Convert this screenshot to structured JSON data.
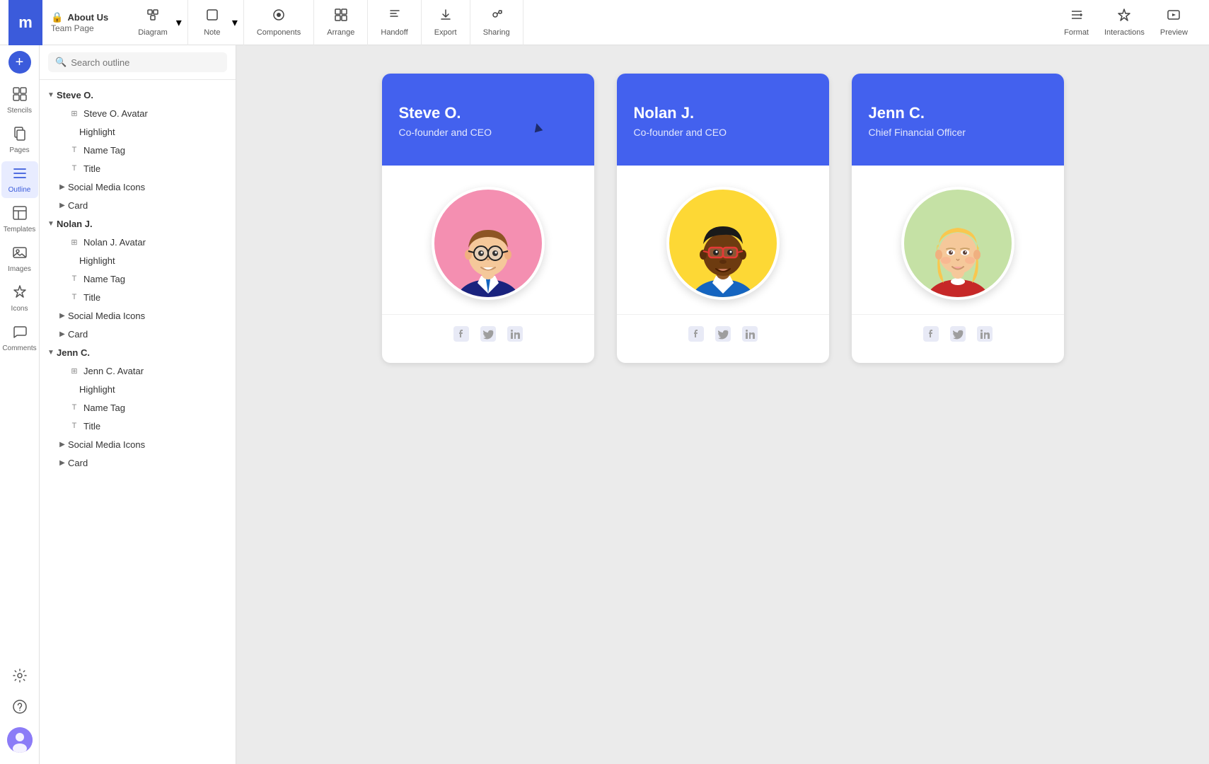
{
  "app": {
    "logo": "m",
    "breadcrumb": {
      "top": "About Us",
      "bottom": "Team Page"
    }
  },
  "toolbar": {
    "items": [
      {
        "id": "diagram",
        "label": "Diagram",
        "icon": "⬡"
      },
      {
        "id": "note",
        "label": "Note",
        "icon": "□"
      },
      {
        "id": "components",
        "label": "Components",
        "icon": "◉"
      },
      {
        "id": "arrange",
        "label": "Arrange",
        "icon": "⊞"
      },
      {
        "id": "handoff",
        "label": "Handoff",
        "icon": "</>"
      },
      {
        "id": "export",
        "label": "Export",
        "icon": "⬇"
      },
      {
        "id": "sharing",
        "label": "Sharing",
        "icon": "＋人"
      },
      {
        "id": "format",
        "label": "Format",
        "icon": "≡"
      },
      {
        "id": "interactions",
        "label": "Interactions",
        "icon": "⚡"
      },
      {
        "id": "preview",
        "label": "Preview",
        "icon": "▶"
      }
    ]
  },
  "rail": {
    "items": [
      {
        "id": "stencils",
        "label": "Stencils",
        "icon": "⊞",
        "active": false
      },
      {
        "id": "pages",
        "label": "Pages",
        "icon": "📄",
        "active": false
      },
      {
        "id": "outline",
        "label": "Outline",
        "icon": "☰",
        "active": true
      },
      {
        "id": "templates",
        "label": "Templates",
        "icon": "▤",
        "active": false
      },
      {
        "id": "images",
        "label": "Images",
        "icon": "🖼",
        "active": false
      },
      {
        "id": "icons",
        "label": "Icons",
        "icon": "✦",
        "active": false
      },
      {
        "id": "comments",
        "label": "Comments",
        "icon": "💬",
        "active": false
      }
    ]
  },
  "outline": {
    "search_placeholder": "Search outline",
    "tree": [
      {
        "id": "steve-root",
        "label": "Steve O.",
        "level": 0,
        "type": "group",
        "open": true
      },
      {
        "id": "steve-avatar",
        "label": "Steve O. Avatar",
        "level": 1,
        "type": "image",
        "open": false
      },
      {
        "id": "steve-highlight",
        "label": "Highlight",
        "level": 2,
        "type": "text",
        "open": false
      },
      {
        "id": "steve-nametag",
        "label": "Name Tag",
        "level": 1,
        "type": "text",
        "open": false
      },
      {
        "id": "steve-title",
        "label": "Title",
        "level": 1,
        "type": "text",
        "open": false
      },
      {
        "id": "steve-social",
        "label": "Social Media Icons",
        "level": 1,
        "type": "group",
        "open": false
      },
      {
        "id": "steve-card",
        "label": "Card",
        "level": 1,
        "type": "group",
        "open": false
      },
      {
        "id": "nolan-root",
        "label": "Nolan J.",
        "level": 0,
        "type": "group",
        "open": true
      },
      {
        "id": "nolan-avatar",
        "label": "Nolan J. Avatar",
        "level": 1,
        "type": "image",
        "open": false
      },
      {
        "id": "nolan-highlight",
        "label": "Highlight",
        "level": 2,
        "type": "text",
        "open": false
      },
      {
        "id": "nolan-nametag",
        "label": "Name Tag",
        "level": 1,
        "type": "text",
        "open": false
      },
      {
        "id": "nolan-title",
        "label": "Title",
        "level": 1,
        "type": "text",
        "open": false
      },
      {
        "id": "nolan-social",
        "label": "Social Media Icons",
        "level": 1,
        "type": "group",
        "open": false
      },
      {
        "id": "nolan-card",
        "label": "Card",
        "level": 1,
        "type": "group",
        "open": false
      },
      {
        "id": "jenn-root",
        "label": "Jenn C.",
        "level": 0,
        "type": "group",
        "open": true
      },
      {
        "id": "jenn-avatar",
        "label": "Jenn C. Avatar",
        "level": 1,
        "type": "image",
        "open": false
      },
      {
        "id": "jenn-highlight",
        "label": "Highlight",
        "level": 2,
        "type": "text",
        "open": false
      },
      {
        "id": "jenn-nametag",
        "label": "Name Tag",
        "level": 1,
        "type": "text",
        "open": false
      },
      {
        "id": "jenn-title",
        "label": "Title",
        "level": 1,
        "type": "text",
        "open": false
      },
      {
        "id": "jenn-social",
        "label": "Social Media Icons",
        "level": 1,
        "type": "group",
        "open": false
      },
      {
        "id": "jenn-card",
        "label": "Card",
        "level": 1,
        "type": "group",
        "open": false
      }
    ]
  },
  "cards": [
    {
      "id": "steve",
      "name": "Steve O.",
      "title": "Co-founder and CEO",
      "avatar_bg": "pink",
      "social": [
        "facebook",
        "twitter",
        "linkedin"
      ]
    },
    {
      "id": "nolan",
      "name": "Nolan J.",
      "title": "Co-founder and CEO",
      "avatar_bg": "yellow",
      "social": [
        "facebook",
        "twitter",
        "linkedin"
      ]
    },
    {
      "id": "jenn",
      "name": "Jenn C.",
      "title": "Chief Financial Officer",
      "avatar_bg": "green",
      "social": [
        "facebook",
        "twitter",
        "linkedin"
      ]
    }
  ]
}
